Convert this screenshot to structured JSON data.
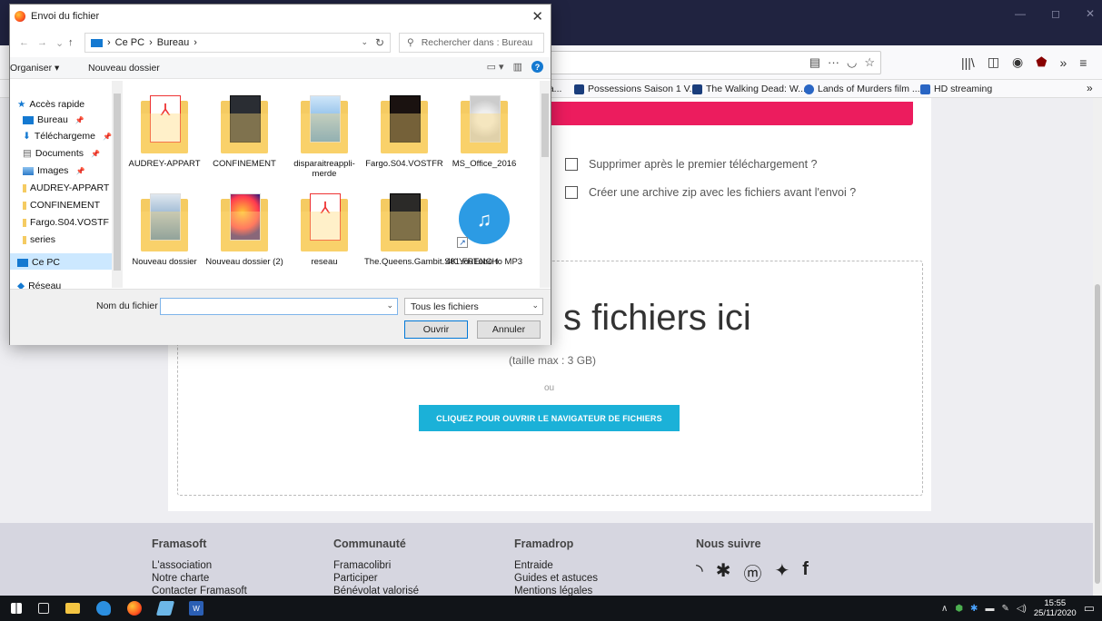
{
  "dialog": {
    "title": "Envoi du fichier",
    "close": "✕",
    "nav": {
      "back": "←",
      "forward": "→",
      "down": "⌄",
      "up": "↑"
    },
    "path": [
      "Ce PC",
      "Bureau"
    ],
    "search_placeholder": "Rechercher dans : Bureau",
    "toolbar": {
      "organize": "Organiser ▾",
      "new_folder": "Nouveau dossier",
      "help": "?"
    },
    "nav_pane": {
      "quick_access": "Accès rapide",
      "items": [
        {
          "label": "Bureau",
          "pinned": true
        },
        {
          "label": "Téléchargeme",
          "pinned": true
        },
        {
          "label": "Documents",
          "pinned": true
        },
        {
          "label": "Images",
          "pinned": true
        },
        {
          "label": "AUDREY-APPART",
          "pinned": false
        },
        {
          "label": "CONFINEMENT",
          "pinned": false
        },
        {
          "label": "Fargo.S04.VOSTF",
          "pinned": false
        },
        {
          "label": "series",
          "pinned": false
        }
      ],
      "this_pc": "Ce PC",
      "network": "Réseau"
    },
    "files": [
      {
        "name": "AUDREY-APPART",
        "kind": "folder-pdf"
      },
      {
        "name": "CONFINEMENT",
        "kind": "folder-dark"
      },
      {
        "name": "disparaitreappli-merde",
        "kind": "folder-doc"
      },
      {
        "name": "Fargo.S04.VOSTFR",
        "kind": "folder-dark"
      },
      {
        "name": "MS_Office_2016",
        "kind": "folder-disc"
      },
      {
        "name": "Nouveau dossier",
        "kind": "folder-doc"
      },
      {
        "name": "Nouveau dossier (2)",
        "kind": "folder-firefox"
      },
      {
        "name": "reseau",
        "kind": "folder-pdf"
      },
      {
        "name": "The.Queens.Gambit.S01.FRENCH",
        "kind": "folder-dark"
      },
      {
        "name": "4K YouTube to MP3",
        "kind": "app-shortcut"
      }
    ],
    "filename_label": "Nom du fichier :",
    "filename_value": "",
    "filter_value": "Tous les fichiers",
    "open_button": "Ouvrir",
    "cancel_button": "Annuler"
  },
  "browser": {
    "window_controls": {
      "minimize": "—",
      "maximize": "◻",
      "close": "✕"
    },
    "bookmarks": [
      {
        "label": "ea...",
        "icon_color": "#999999"
      },
      {
        "label": "Possessions Saison 1 V...",
        "icon_color": "#1a3d7c"
      },
      {
        "label": "The Walking Dead: W...",
        "icon_color": "#1a3d7c"
      },
      {
        "label": "Lands of Murders film ...",
        "icon_color": "#2a66c4"
      },
      {
        "label": "HD streaming",
        "icon_color": "#2a66c4"
      }
    ],
    "bookmarks_overflow": "»",
    "toolbar_icons": [
      "reader-view-icon",
      "more-icon",
      "pocket-icon",
      "bookmark-star-icon"
    ],
    "toolbar_right": [
      "library-icon",
      "sidebar-icon",
      "account-icon",
      "ublock-icon",
      "overflow-icon",
      "menu-icon"
    ]
  },
  "page": {
    "options": [
      "Supprimer après le premier téléchargement ?",
      "Créer une archive zip avec les fichiers avant l'envoi ?"
    ],
    "drop_title": "s fichiers ici",
    "max_size": "(taille max : 3 GB)",
    "or": "ou",
    "browse_button": "CLIQUEZ POUR OUVRIR LE NAVIGATEUR DE FICHIERS",
    "accent_color": "#ec1c5e",
    "button_color": "#1bb1d8"
  },
  "footer": {
    "columns": [
      {
        "title": "Framasoft",
        "links": [
          "L'association",
          "Notre charte",
          "Contacter Framasoft"
        ]
      },
      {
        "title": "Communauté",
        "links": [
          "Framacolibri",
          "Participer",
          "Bénévolat valorisé"
        ]
      },
      {
        "title": "Framadrop",
        "links": [
          "Entraide",
          "Guides et astuces",
          "Mentions légales"
        ]
      },
      {
        "title": "Nous suivre",
        "links": []
      }
    ],
    "social_icons": [
      "rss-icon",
      "diaspora-icon",
      "mastodon-icon",
      "twitter-icon",
      "facebook-icon"
    ]
  },
  "taskbar": {
    "apps": [
      "windows-start-icon",
      "task-view-icon",
      "file-explorer-icon",
      "edge-icon",
      "firefox-icon",
      "app-icon",
      "word-icon"
    ],
    "time": "15:55",
    "date": "25/11/2020"
  }
}
